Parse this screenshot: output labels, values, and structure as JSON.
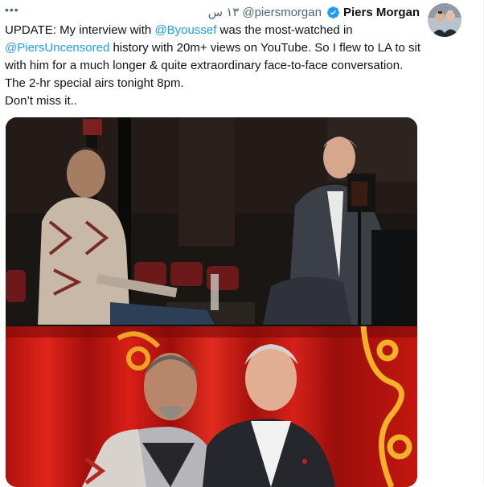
{
  "tweet": {
    "more_label": "•••",
    "author_name": "Piers Morgan",
    "author_handle": "@piersmorgan",
    "timestamp": "١٣ س",
    "verified_icon": "verified-badge-icon",
    "more_icon": "more-options-icon",
    "text": {
      "line1_pre": "UPDATE: My interview with ",
      "mention1": "@Byoussef",
      "line1_post": " was the most-watched in",
      "mention2": "@PiersUncensored",
      "line2_post": " history with 20m+ views on YouTube. So I flew to LA to sit with him for a much longer & quite extraordinary face-to-face conversation. The 2-hr special airs tonight 8pm.",
      "line3": "Don’t miss it.."
    }
  },
  "colors": {
    "accent": "#1d9bf0",
    "text": "#0f1419",
    "secondary": "#536471"
  }
}
